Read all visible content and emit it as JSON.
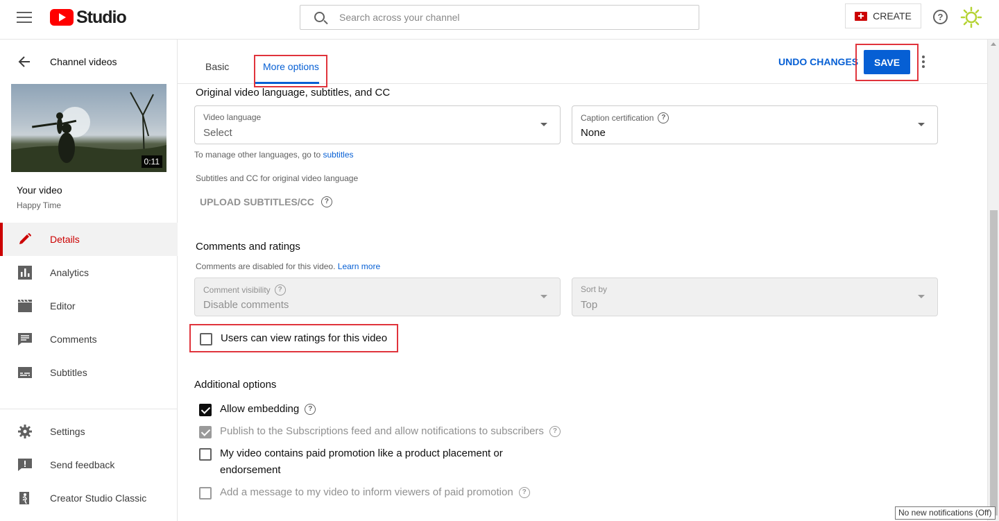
{
  "header": {
    "logo_text": "Studio",
    "search_placeholder": "Search across your channel",
    "create_label": "CREATE"
  },
  "sidebar": {
    "back_label": "Channel videos",
    "thumbnail_duration": "0:11",
    "your_video_label": "Your video",
    "video_title": "Happy Time",
    "items": [
      {
        "label": "Details",
        "icon": "pencil-icon",
        "active": true
      },
      {
        "label": "Analytics",
        "icon": "analytics-icon"
      },
      {
        "label": "Editor",
        "icon": "editor-icon"
      },
      {
        "label": "Comments",
        "icon": "comments-icon"
      },
      {
        "label": "Subtitles",
        "icon": "subtitles-icon"
      }
    ],
    "bottom_items": [
      {
        "label": "Settings",
        "icon": "gear-icon"
      },
      {
        "label": "Send feedback",
        "icon": "feedback-icon"
      },
      {
        "label": "Creator Studio Classic",
        "icon": "classic-studio-icon"
      }
    ]
  },
  "tabs": {
    "basic": "Basic",
    "more_options": "More options",
    "active": "More options"
  },
  "actions": {
    "undo": "UNDO CHANGES",
    "save": "SAVE"
  },
  "language_section": {
    "title": "Original video language, subtitles, and CC",
    "video_language_label": "Video language",
    "video_language_value": "Select",
    "caption_cert_label": "Caption certification",
    "caption_cert_value": "None",
    "manage_text": "To manage other languages, go to",
    "manage_link": "subtitles",
    "subtitles_cc_label": "Subtitles and CC for original video language",
    "upload_label": "UPLOAD SUBTITLES/CC"
  },
  "comments_section": {
    "title": "Comments and ratings",
    "disabled_text": "Comments are disabled for this video.",
    "learn_more": "Learn more",
    "visibility_label": "Comment visibility",
    "visibility_value": "Disable comments",
    "sort_label": "Sort by",
    "sort_value": "Top",
    "ratings_label": "Users can view ratings for this video",
    "ratings_checked": false
  },
  "additional_section": {
    "title": "Additional options",
    "options": [
      {
        "label": "Allow embedding",
        "checked": true
      },
      {
        "label": "Publish to the Subscriptions feed and allow notifications to subscribers",
        "checked": true,
        "disabled": true
      },
      {
        "label_line1": "My video contains paid promotion like a product placement or",
        "label_line2": "endorsement",
        "checked": false
      },
      {
        "label": "Add a message to my video to inform viewers of paid promotion",
        "checked": false,
        "disabled": true
      }
    ]
  },
  "tooltip": "No new notifications (Off)",
  "colors": {
    "accent": "#065fd4",
    "brand_red": "#cc0000",
    "highlight": "#e0333b"
  }
}
